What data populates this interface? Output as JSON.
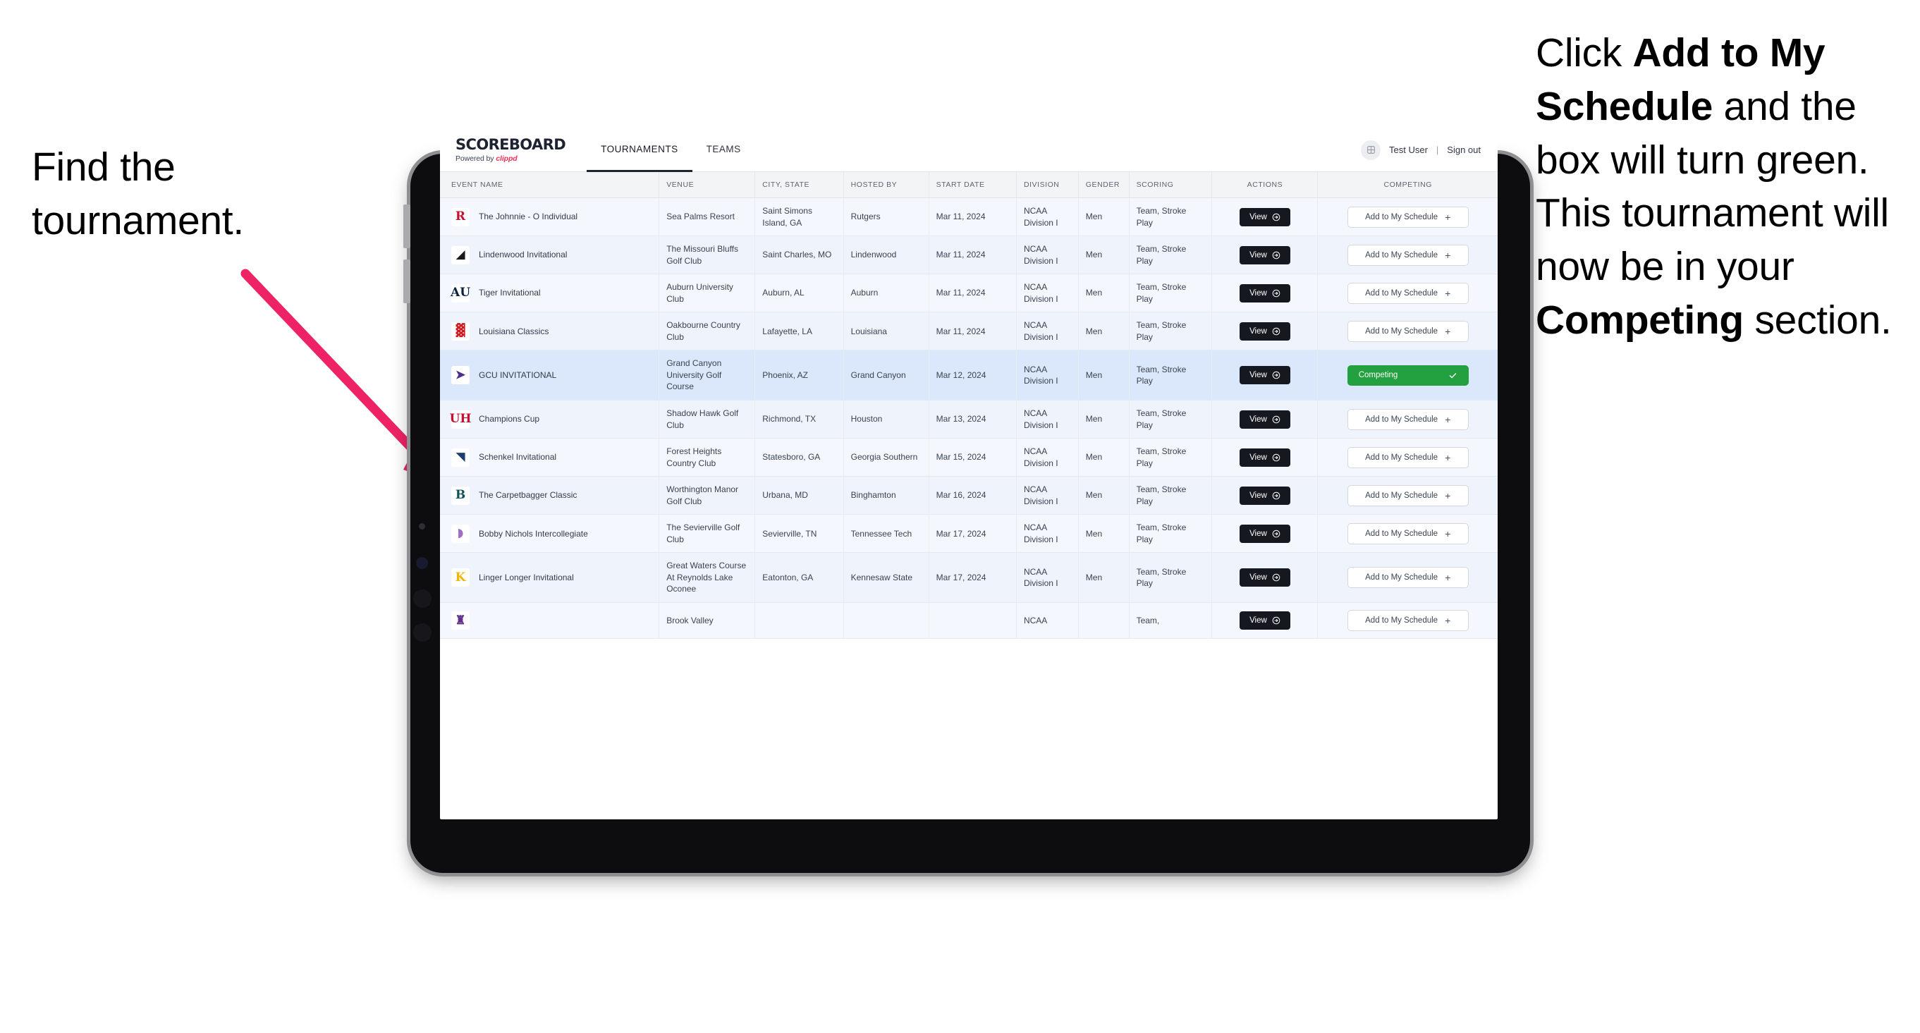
{
  "annotations": {
    "left": {
      "segments": [
        {
          "text": "Find the tournament.",
          "bold": false
        }
      ]
    },
    "right": {
      "segments": [
        {
          "text": "Click ",
          "bold": false
        },
        {
          "text": "Add to My Schedule",
          "bold": true
        },
        {
          "text": " and the box will turn green. This tournament will now be in your ",
          "bold": false
        },
        {
          "text": "Competing",
          "bold": true
        },
        {
          "text": " section.",
          "bold": false
        }
      ]
    },
    "arrow_color": "#ED2365"
  },
  "app": {
    "brand": {
      "title": "SCOREBOARD",
      "powered_prefix": "Powered by ",
      "powered_name": "clippd"
    },
    "nav": [
      {
        "label": "TOURNAMENTS",
        "active": true
      },
      {
        "label": "TEAMS",
        "active": false
      }
    ],
    "account": {
      "user": "Test User",
      "separator": "|",
      "signout": "Sign out",
      "avatar_icon": "user-avatar-icon"
    }
  },
  "table": {
    "columns": [
      "EVENT NAME",
      "VENUE",
      "CITY, STATE",
      "HOSTED BY",
      "START DATE",
      "DIVISION",
      "GENDER",
      "SCORING",
      "ACTIONS",
      "COMPETING"
    ],
    "view_button_label": "View",
    "add_button_label": "Add to My Schedule",
    "add_button_plus": "+",
    "competing_button_label": "Competing",
    "rows": [
      {
        "event": "The Johnnie - O Individual",
        "venue": "Sea Palms Resort",
        "city": "Saint Simons Island, GA",
        "host": "Rutgers",
        "date": "Mar 11, 2024",
        "division": "NCAA Division I",
        "gender": "Men",
        "scoring": "Team, Stroke Play",
        "competing": false,
        "logo": {
          "glyph": "R",
          "bg": "#ffffff",
          "fg": "#c8102e"
        }
      },
      {
        "event": "Lindenwood Invitational",
        "venue": "The Missouri Bluffs Golf Club",
        "city": "Saint Charles, MO",
        "host": "Lindenwood",
        "date": "Mar 11, 2024",
        "division": "NCAA Division I",
        "gender": "Men",
        "scoring": "Team, Stroke Play",
        "competing": false,
        "logo": {
          "glyph": "◢",
          "bg": "#ffffff",
          "fg": "#1a1a1a"
        }
      },
      {
        "event": "Tiger Invitational",
        "venue": "Auburn University Club",
        "city": "Auburn, AL",
        "host": "Auburn",
        "date": "Mar 11, 2024",
        "division": "NCAA Division I",
        "gender": "Men",
        "scoring": "Team, Stroke Play",
        "competing": false,
        "logo": {
          "glyph": "AU",
          "bg": "#ffffff",
          "fg": "#0c2340"
        }
      },
      {
        "event": "Louisiana Classics",
        "venue": "Oakbourne Country Club",
        "city": "Lafayette, LA",
        "host": "Louisiana",
        "date": "Mar 11, 2024",
        "division": "NCAA Division I",
        "gender": "Men",
        "scoring": "Team, Stroke Play",
        "competing": false,
        "logo": {
          "glyph": "▓",
          "bg": "#ffffff",
          "fg": "#ce181e"
        }
      },
      {
        "event": "GCU INVITATIONAL",
        "venue": "Grand Canyon University Golf Course",
        "city": "Phoenix, AZ",
        "host": "Grand Canyon",
        "date": "Mar 12, 2024",
        "division": "NCAA Division I",
        "gender": "Men",
        "scoring": "Team, Stroke Play",
        "competing": true,
        "logo": {
          "glyph": "➤",
          "bg": "#ffffff",
          "fg": "#4f2d8c"
        }
      },
      {
        "event": "Champions Cup",
        "venue": "Shadow Hawk Golf Club",
        "city": "Richmond, TX",
        "host": "Houston",
        "date": "Mar 13, 2024",
        "division": "NCAA Division I",
        "gender": "Men",
        "scoring": "Team, Stroke Play",
        "competing": false,
        "logo": {
          "glyph": "UH",
          "bg": "#ffffff",
          "fg": "#c8102e"
        }
      },
      {
        "event": "Schenkel Invitational",
        "venue": "Forest Heights Country Club",
        "city": "Statesboro, GA",
        "host": "Georgia Southern",
        "date": "Mar 15, 2024",
        "division": "NCAA Division I",
        "gender": "Men",
        "scoring": "Team, Stroke Play",
        "competing": false,
        "logo": {
          "glyph": "◥",
          "bg": "#ffffff",
          "fg": "#1c3f6e"
        }
      },
      {
        "event": "The Carpetbagger Classic",
        "venue": "Worthington Manor Golf Club",
        "city": "Urbana, MD",
        "host": "Binghamton",
        "date": "Mar 16, 2024",
        "division": "NCAA Division I",
        "gender": "Men",
        "scoring": "Team, Stroke Play",
        "competing": false,
        "logo": {
          "glyph": "B",
          "bg": "#ffffff",
          "fg": "#0d5257"
        }
      },
      {
        "event": "Bobby Nichols Intercollegiate",
        "venue": "The Sevierville Golf Club",
        "city": "Sevierville, TN",
        "host": "Tennessee Tech",
        "date": "Mar 17, 2024",
        "division": "NCAA Division I",
        "gender": "Men",
        "scoring": "Team, Stroke Play",
        "competing": false,
        "logo": {
          "glyph": "◗",
          "bg": "#ffffff",
          "fg": "#a06fc4"
        }
      },
      {
        "event": "Linger Longer Invitational",
        "venue": "Great Waters Course At Reynolds Lake Oconee",
        "city": "Eatonton, GA",
        "host": "Kennesaw State",
        "date": "Mar 17, 2024",
        "division": "NCAA Division I",
        "gender": "Men",
        "scoring": "Team, Stroke Play",
        "competing": false,
        "logo": {
          "glyph": "K",
          "bg": "#ffffff",
          "fg": "#f5b400"
        }
      },
      {
        "event": "",
        "venue": "Brook Valley",
        "city": "",
        "host": "",
        "date": "",
        "division": "NCAA",
        "gender": "",
        "scoring": "Team,",
        "competing": false,
        "logo": {
          "glyph": "♜",
          "bg": "#ffffff",
          "fg": "#63308c"
        }
      }
    ]
  }
}
